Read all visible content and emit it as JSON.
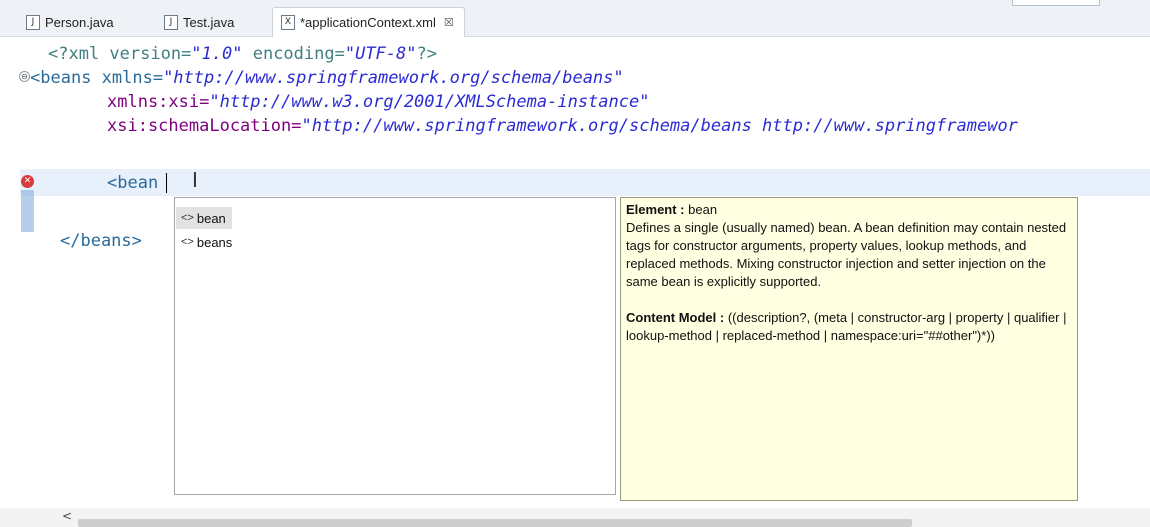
{
  "tabs": [
    {
      "label": "Person.java",
      "icon": "java-file-icon",
      "icon_glyph": "J"
    },
    {
      "label": "Test.java",
      "icon": "java-file-icon",
      "icon_glyph": "J"
    },
    {
      "label": "*applicationContext.xml",
      "icon": "xml-file-icon",
      "icon_glyph": "X",
      "active": true,
      "close_glyph": "☒"
    }
  ],
  "editor": {
    "lines": [
      {
        "parts": [
          "<?xml version=",
          "\"1.0\"",
          " encoding=",
          "\"UTF-8\"",
          "?>"
        ]
      },
      {
        "parts": [
          "<beans xmlns=",
          "\"http://www.springframework.org/schema/beans\""
        ]
      },
      {
        "parts": [
          "xmlns:xsi=",
          "\"http://www.w3.org/2001/XMLSchema-instance\""
        ]
      },
      {
        "parts": [
          "xsi:schemaLocation=",
          "\"http://www.springframework.org/schema/beans http://www.springframewor"
        ]
      },
      {
        "parts": [
          "<bean"
        ]
      },
      {
        "parts": [
          "</beans>"
        ]
      }
    ],
    "fold_glyph": "⊖",
    "error_glyph": "✕",
    "ibeam_glyph": "I"
  },
  "autocomplete": {
    "items": [
      {
        "label": "bean",
        "icon": "tag-icon",
        "glyph": "<>",
        "selected": true
      },
      {
        "label": "beans",
        "icon": "tag-icon",
        "glyph": "<>",
        "selected": false
      }
    ]
  },
  "doc": {
    "element_label": "Element :",
    "element_value": "bean",
    "description": "Defines a single (usually named) bean. A bean definition may contain nested tags for constructor arguments, property values, lookup methods, and replaced methods. Mixing constructor injection and setter injection on the same bean is explicitly supported.",
    "content_model_label": "Content Model :",
    "content_model_value": "((description?, (meta | constructor-arg | property | qualifier | lookup-method | replaced-method | namespace:uri=\"##other\")*))"
  },
  "hscroll": {
    "left_arrow": "<"
  },
  "colors": {
    "current_line": "#e8f0fb",
    "error": "#d63c3c",
    "doc_background": "#ffffe1",
    "string_literal": "#2b2bd4",
    "tag": "#2a6a9a"
  }
}
